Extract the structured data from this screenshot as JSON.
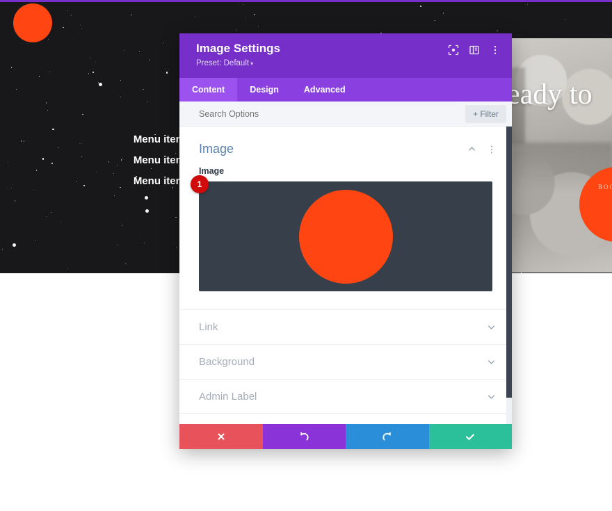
{
  "background": {
    "hero": {
      "menu_items": [
        "Menu item",
        "Menu item",
        "Menu item"
      ],
      "headline": "eady to",
      "book_button_label": "BOO",
      "accent_color": "#ff4612",
      "background_color": "#18181a"
    },
    "top_rule_color": "#7630c9"
  },
  "modal": {
    "title": "Image Settings",
    "preset_label": "Preset: Default",
    "preset_caret": "▾",
    "header_icons": [
      {
        "name": "focus-icon"
      },
      {
        "name": "layout-panel-icon"
      },
      {
        "name": "kebab-menu-icon"
      }
    ],
    "tabs": [
      {
        "label": "Content",
        "active": true
      },
      {
        "label": "Design",
        "active": false
      },
      {
        "label": "Advanced",
        "active": false
      }
    ],
    "search": {
      "placeholder": "Search Options",
      "value": ""
    },
    "filter_button_label": "+ Filter",
    "section": {
      "title": "Image",
      "collapse_icon": "chevron-up-icon",
      "menu_icon": "kebab-menu-icon"
    },
    "image_field": {
      "label": "Image",
      "badge": "1",
      "badge_color": "#d10b0b",
      "preview_background": "#373f4a",
      "preview_shape_color": "#ff4612"
    },
    "accordion": [
      {
        "label": "Link",
        "icon": "chevron-down-icon"
      },
      {
        "label": "Background",
        "icon": "chevron-down-icon"
      },
      {
        "label": "Admin Label",
        "icon": "chevron-down-icon"
      }
    ],
    "footer_buttons": [
      {
        "name": "discard-button",
        "icon": "close-icon",
        "color": "#e8525a"
      },
      {
        "name": "undo-button",
        "icon": "undo-icon",
        "color": "#8a33d8"
      },
      {
        "name": "redo-button",
        "icon": "redo-icon",
        "color": "#2a8fd8"
      },
      {
        "name": "save-button",
        "icon": "check-icon",
        "color": "#2bbf9a"
      }
    ],
    "accent_color": "#7630c9"
  }
}
